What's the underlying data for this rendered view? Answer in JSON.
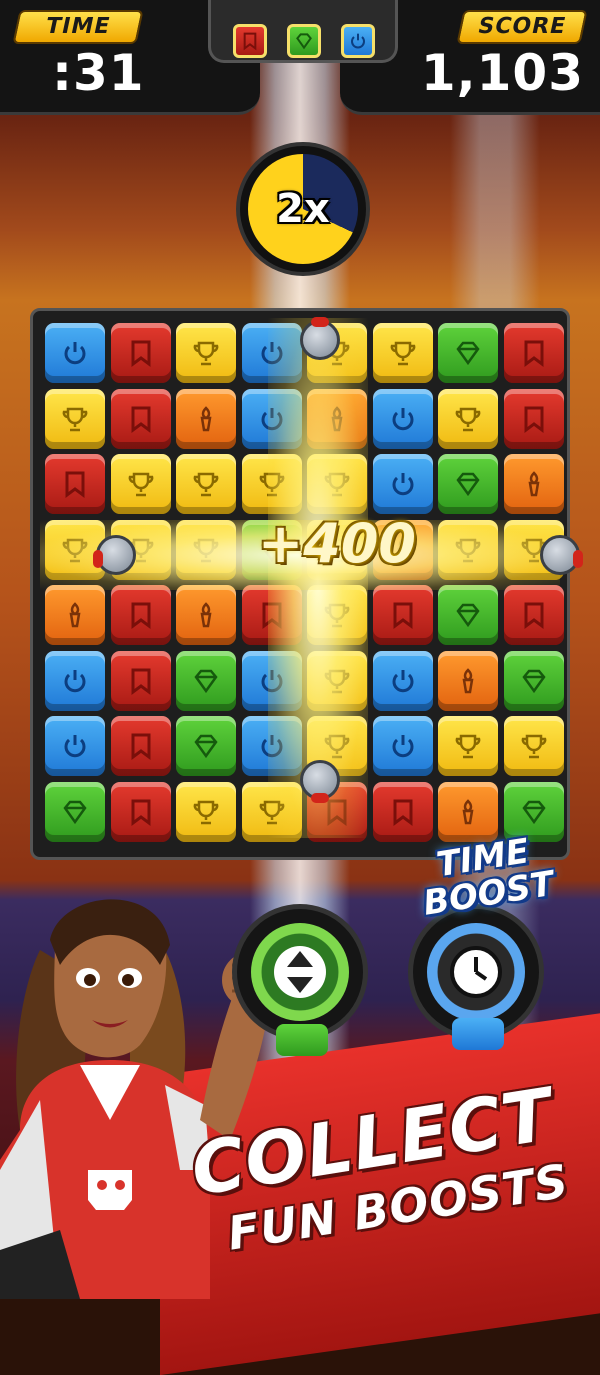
{
  "hud": {
    "time_label": "TIME",
    "time_value": ":31",
    "score_label": "SCORE",
    "score_value": "1,103"
  },
  "goals": [
    {
      "icon": "banner-icon",
      "color": "#d42a22"
    },
    {
      "icon": "gem-icon",
      "color": "#3fae2a"
    },
    {
      "icon": "power-icon",
      "color": "#2f8ce6"
    }
  ],
  "multiplier": {
    "label": "2x",
    "fill_fraction": 0.68
  },
  "score_popup": "+400",
  "board": {
    "rows": [
      [
        "blue",
        "red",
        "yellow",
        "blue",
        "yellow",
        "yellow",
        "green",
        "red"
      ],
      [
        "yellow",
        "red",
        "orange",
        "blue",
        "orange",
        "blue",
        "yellow",
        "red"
      ],
      [
        "red",
        "yellow",
        "yellow",
        "yellow",
        "yellow",
        "blue",
        "green",
        "orange"
      ],
      [
        "yellow",
        "yellow",
        "yellow",
        "green",
        "yellow",
        "orange",
        "yellow",
        "yellow"
      ],
      [
        "orange",
        "red",
        "orange",
        "red",
        "yellow",
        "red",
        "green",
        "red"
      ],
      [
        "blue",
        "red",
        "green",
        "blue",
        "yellow",
        "blue",
        "orange",
        "green"
      ],
      [
        "blue",
        "red",
        "green",
        "blue",
        "yellow",
        "blue",
        "yellow",
        "yellow"
      ],
      [
        "green",
        "red",
        "yellow",
        "yellow",
        "red",
        "red",
        "orange",
        "green"
      ]
    ],
    "icons": {
      "blue": "power-icon",
      "red": "banner-icon",
      "yellow": "trophy-icon",
      "green": "gem-icon",
      "orange": "torch-icon"
    },
    "colors": {
      "blue": "#2f8ce6",
      "red": "#d42a22",
      "yellow": "#f7d21e",
      "green": "#3fae2a",
      "orange": "#f07d1a"
    }
  },
  "boosts": [
    {
      "name": "swap",
      "icon": "swap-arrows-icon"
    },
    {
      "name": "time",
      "icon": "clock-icon",
      "label_line1": "TIME",
      "label_line2": "BOOST"
    }
  ],
  "promo": {
    "line1": "COLLECT",
    "line2": "FUN BOOSTS"
  }
}
